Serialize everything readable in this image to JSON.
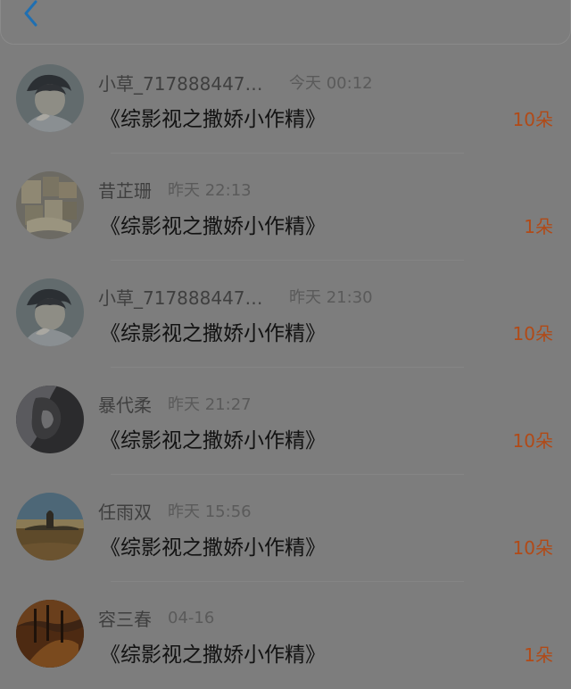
{
  "header": {
    "back_icon": "chevron-left-icon",
    "accent_color": "#1f6fb2"
  },
  "list": {
    "items": [
      {
        "name": "小草_7178884475...",
        "time": "今天 00:12",
        "book": "《综影视之撒娇小作精》",
        "amount": "10朵",
        "avatar": "anime-boy-avatar"
      },
      {
        "name": "昔芷珊",
        "time": "昨天 22:13",
        "book": "《综影视之撒娇小作精》",
        "amount": "1朵",
        "avatar": "collage-avatar"
      },
      {
        "name": "小草_7178884475...",
        "time": "昨天 21:30",
        "book": "《综影视之撒娇小作精》",
        "amount": "10朵",
        "avatar": "anime-boy-avatar"
      },
      {
        "name": "暴代柔",
        "time": "昨天 21:27",
        "book": "《综影视之撒娇小作精》",
        "amount": "10朵",
        "avatar": "dark-portrait-avatar"
      },
      {
        "name": "任雨双",
        "time": "昨天 15:56",
        "book": "《综影视之撒娇小作精》",
        "amount": "10朵",
        "avatar": "landscape-avatar"
      },
      {
        "name": "容三春",
        "time": "04-16",
        "book": "《综影视之撒娇小作精》",
        "amount": "1朵",
        "avatar": "autumn-avatar"
      }
    ]
  }
}
